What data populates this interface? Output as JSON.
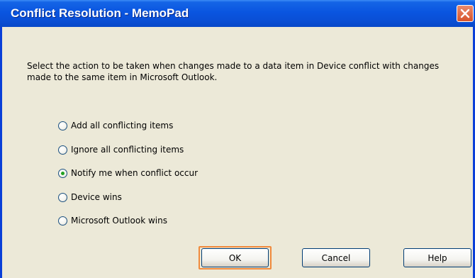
{
  "window": {
    "title": "Conflict Resolution - MemoPad",
    "close_icon": "close-icon"
  },
  "dialog": {
    "message": "Select the action to be taken when changes made to a data item in Device conflict with changes made to the same item in Microsoft Outlook.",
    "selected_option": "Notify me when conflict occur",
    "options": [
      {
        "label": "Add all conflicting items",
        "selected": false
      },
      {
        "label": "Ignore all conflicting items",
        "selected": false
      },
      {
        "label": "Notify me when conflict occur",
        "selected": true
      },
      {
        "label": "Device wins",
        "selected": false
      },
      {
        "label": "Microsoft Outlook wins",
        "selected": false
      }
    ]
  },
  "buttons": {
    "ok": "OK",
    "cancel": "Cancel",
    "help": "Help"
  },
  "colors": {
    "title_bar": "#0a55e0",
    "dialog_bg": "#ece9d8",
    "close_button": "#d8542a",
    "focus_highlight": "#f08a3c",
    "radio_dot": "#21a121"
  }
}
